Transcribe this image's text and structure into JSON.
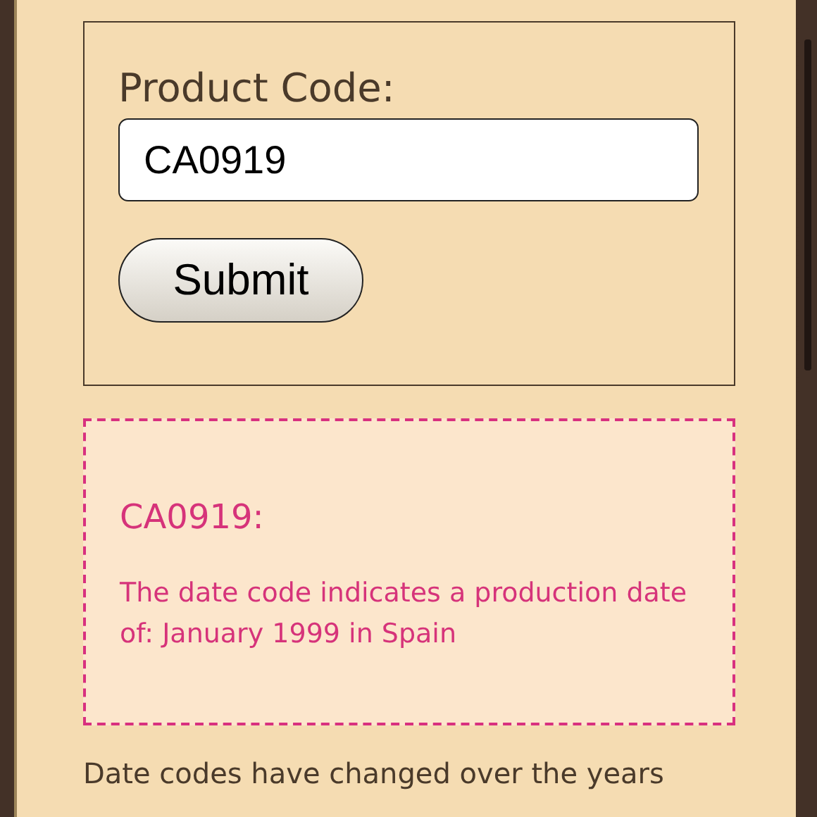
{
  "form": {
    "label": "Product Code:",
    "value": "CA0919",
    "button": "Submit"
  },
  "result": {
    "heading": "CA0919:",
    "message": "The date code indicates a production date of: January 1999 in Spain"
  },
  "intro": "Date codes have changed over the years"
}
